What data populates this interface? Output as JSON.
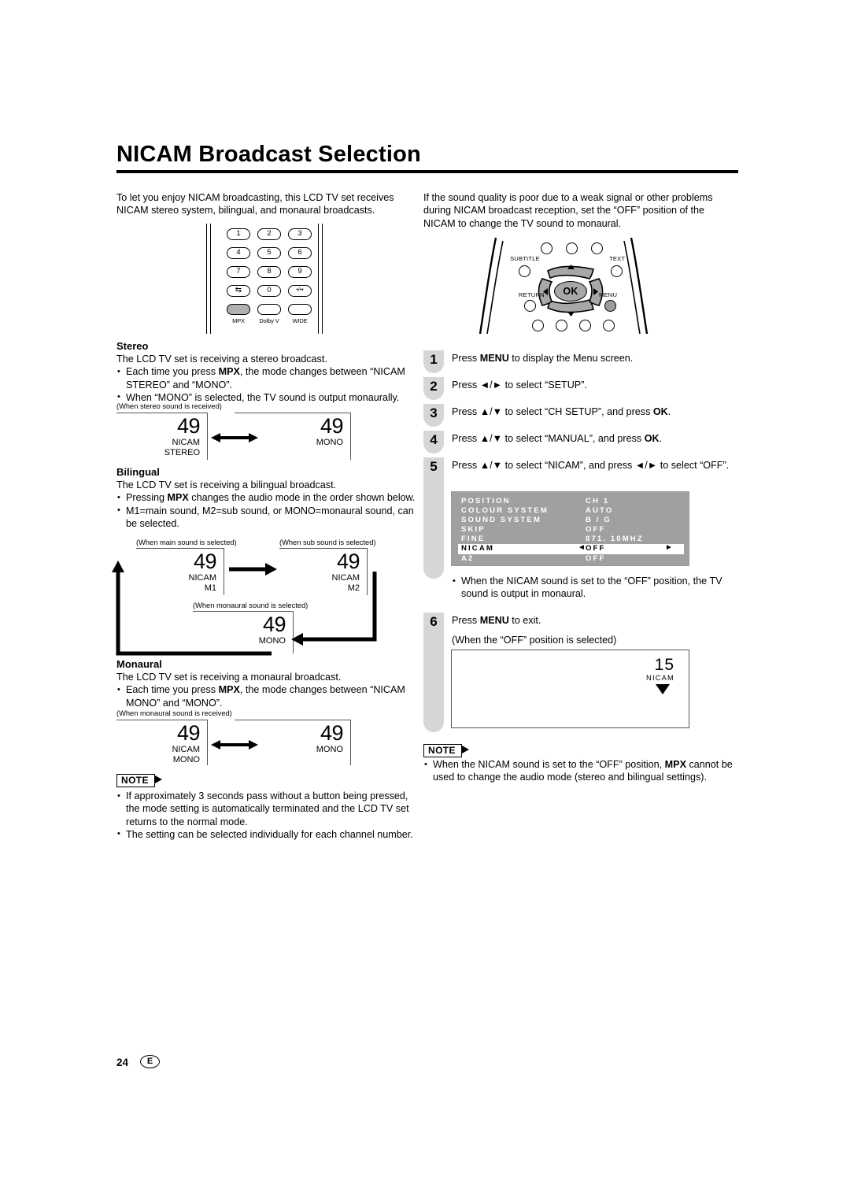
{
  "page": {
    "title": "NICAM Broadcast Selection",
    "footer_number": "24",
    "footer_lang": "E"
  },
  "intro": {
    "left": "To let you enjoy NICAM broadcasting, this LCD TV set receives NICAM stereo system, bilingual, and monaural broadcasts.",
    "right": "If the sound quality is poor due to a weak signal or other problems during NICAM broadcast reception, set the “OFF” position of the NICAM to change the TV sound to monaural."
  },
  "remote_keypad": {
    "keys": [
      "1",
      "2",
      "3",
      "4",
      "5",
      "6",
      "7",
      "8",
      "9"
    ],
    "swap_key": "⇆",
    "zero_key": "0",
    "dot_key": "•/••",
    "function_captions": [
      "MPX",
      "Dolby V",
      "WIDE"
    ]
  },
  "remote_dpad": {
    "ok_label": "OK",
    "subtitle_label": "SUBTITLE",
    "text_label": "TEXT",
    "return_label": "RETURN",
    "menu_label": "MENU",
    "up_arrow": "▲",
    "down_arrow": "▼",
    "left_arrow": "◄",
    "right_arrow": "►"
  },
  "stereo": {
    "heading": "Stereo",
    "line": "The LCD TV set is receiving a stereo broadcast.",
    "bullets": [
      "Each time you press MPX, the mode changes between “NICAM STEREO” and “MONO”.",
      "When “MONO” is selected, the TV sound is output monaurally."
    ],
    "bullet1_pre": "Each time you press ",
    "bullet1_bold": "MPX",
    "bullet1_post": ", the mode changes between “NICAM STEREO” and “MONO”.",
    "bullet2": "When “MONO” is selected, the TV sound is output monaurally.",
    "caption": "(When stereo sound is received)",
    "box_left": {
      "number": "49",
      "label": "NICAM\nSTEREO"
    },
    "box_right": {
      "number": "49",
      "label": "MONO"
    }
  },
  "bilingual": {
    "heading": "Bilingual",
    "line": "The LCD TV set is receiving a bilingual broadcast.",
    "bullet1_pre": "Pressing ",
    "bullet1_bold": "MPX",
    "bullet1_post": " changes the audio mode in the order shown below.",
    "bullet2": "M1=main sound, M2=sub sound, or MONO=monaural sound, can be selected.",
    "caption_main": "(When main sound is selected)",
    "caption_sub": "(When sub sound is selected)",
    "caption_mono": "(When monaural sound is selected)",
    "box_m1": {
      "number": "49",
      "label": "NICAM\nM1"
    },
    "box_m2": {
      "number": "49",
      "label": "NICAM\nM2"
    },
    "box_mono": {
      "number": "49",
      "label": "MONO"
    }
  },
  "monaural": {
    "heading": "Monaural",
    "line": "The LCD TV set is receiving a monaural broadcast.",
    "bullet1_pre": "Each time you press ",
    "bullet1_bold": "MPX",
    "bullet1_post": ", the mode changes between “NICAM MONO” and “MONO”.",
    "caption": "(When monaural sound is received)",
    "box_left": {
      "number": "49",
      "label": "NICAM\nMONO"
    },
    "box_right": {
      "number": "49",
      "label": "MONO"
    }
  },
  "note_left": {
    "badge": "NOTE",
    "bullets": [
      "If approximately 3 seconds pass without a button being pressed, the mode setting is automatically terminated and the LCD TV set returns to the normal mode.",
      "The setting can be selected individually for each channel number."
    ]
  },
  "steps": [
    {
      "number": "1",
      "pre": "Press ",
      "bold": "MENU",
      "post": " to display the Menu screen."
    },
    {
      "number": "2",
      "pre": "Press ◄/► to select “SETUP”.",
      "bold": "",
      "post": ""
    },
    {
      "number": "3",
      "pre": "Press ▲/▼ to select “CH SETUP”, and press ",
      "bold": "OK",
      "post": "."
    },
    {
      "number": "4",
      "pre": "Press ▲/▼ to select “MANUAL”, and press ",
      "bold": "OK",
      "post": "."
    },
    {
      "number": "5",
      "pre": "Press ▲/▼ to select “NICAM”, and press ◄/► to select “OFF”.",
      "bold": "",
      "post": ""
    }
  ],
  "osd": {
    "rows": [
      {
        "key": "POSITION",
        "value": "CH 1",
        "highlighted": false
      },
      {
        "key": "COLOUR SYSTEM",
        "value": "AUTO",
        "highlighted": false
      },
      {
        "key": "SOUND SYSTEM",
        "value": "B / G",
        "highlighted": false
      },
      {
        "key": "SKIP",
        "value": "OFF",
        "highlighted": false
      },
      {
        "key": "FINE",
        "value": "871. 10MHZ",
        "highlighted": false
      },
      {
        "key": "NICAM",
        "value": "OFF",
        "highlighted": true,
        "left_arrow": "◄",
        "right_arrow": "►"
      },
      {
        "key": "A2",
        "value": "OFF",
        "highlighted": false
      }
    ],
    "bg_color": "#a0a0a0",
    "text_color": "#ffffff",
    "highlight_bg": "#ffffff"
  },
  "osd_note_bullet": "When the NICAM sound is set to the “OFF” position, the TV sound is output in monaural.",
  "step6": {
    "number": "6",
    "pre": "Press ",
    "bold": "MENU",
    "post": " to exit.",
    "sub": "(When the “OFF” position is selected)"
  },
  "channel_display": {
    "number": "15",
    "label": "NICAM",
    "arrow": "▼"
  },
  "note_right": {
    "badge": "NOTE",
    "bullet_pre": "When the NICAM sound is set to the “OFF” position, ",
    "bullet_bold": "MPX",
    "bullet_post": " cannot be used to change the audio mode (stereo and bilingual settings)."
  }
}
